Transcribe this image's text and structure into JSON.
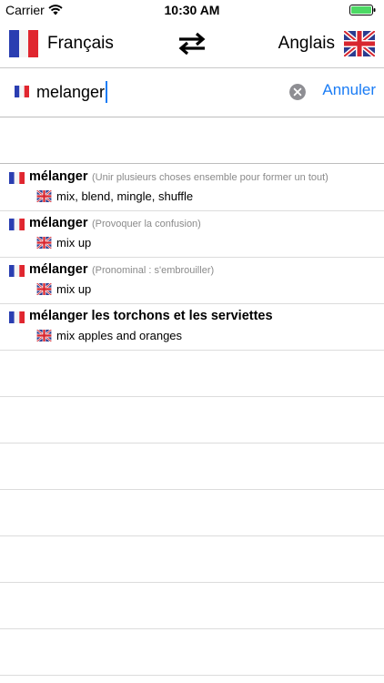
{
  "status_bar": {
    "carrier": "Carrier",
    "time": "10:30 AM"
  },
  "header": {
    "source_lang": "Français",
    "target_lang": "Anglais"
  },
  "search": {
    "query": "melanger",
    "cancel_label": "Annuler"
  },
  "results": [
    {
      "headword": "mélanger",
      "note": "(Unir plusieurs choses ensemble pour former un tout)",
      "translation": "mix, blend, mingle, shuffle"
    },
    {
      "headword": "mélanger",
      "note": "(Provoquer la confusion)",
      "translation": "mix up"
    },
    {
      "headword": "mélanger",
      "note": "(Pronominal : s'embrouiller)",
      "translation": "mix up"
    },
    {
      "headword": "mélanger les torchons et les serviettes",
      "note": "",
      "translation": "mix apples and oranges"
    }
  ],
  "colors": {
    "accent": "#1a7cf5",
    "note_gray": "#8a8a8a",
    "separator": "#dcdcdc",
    "battery_green": "#4cd964"
  }
}
